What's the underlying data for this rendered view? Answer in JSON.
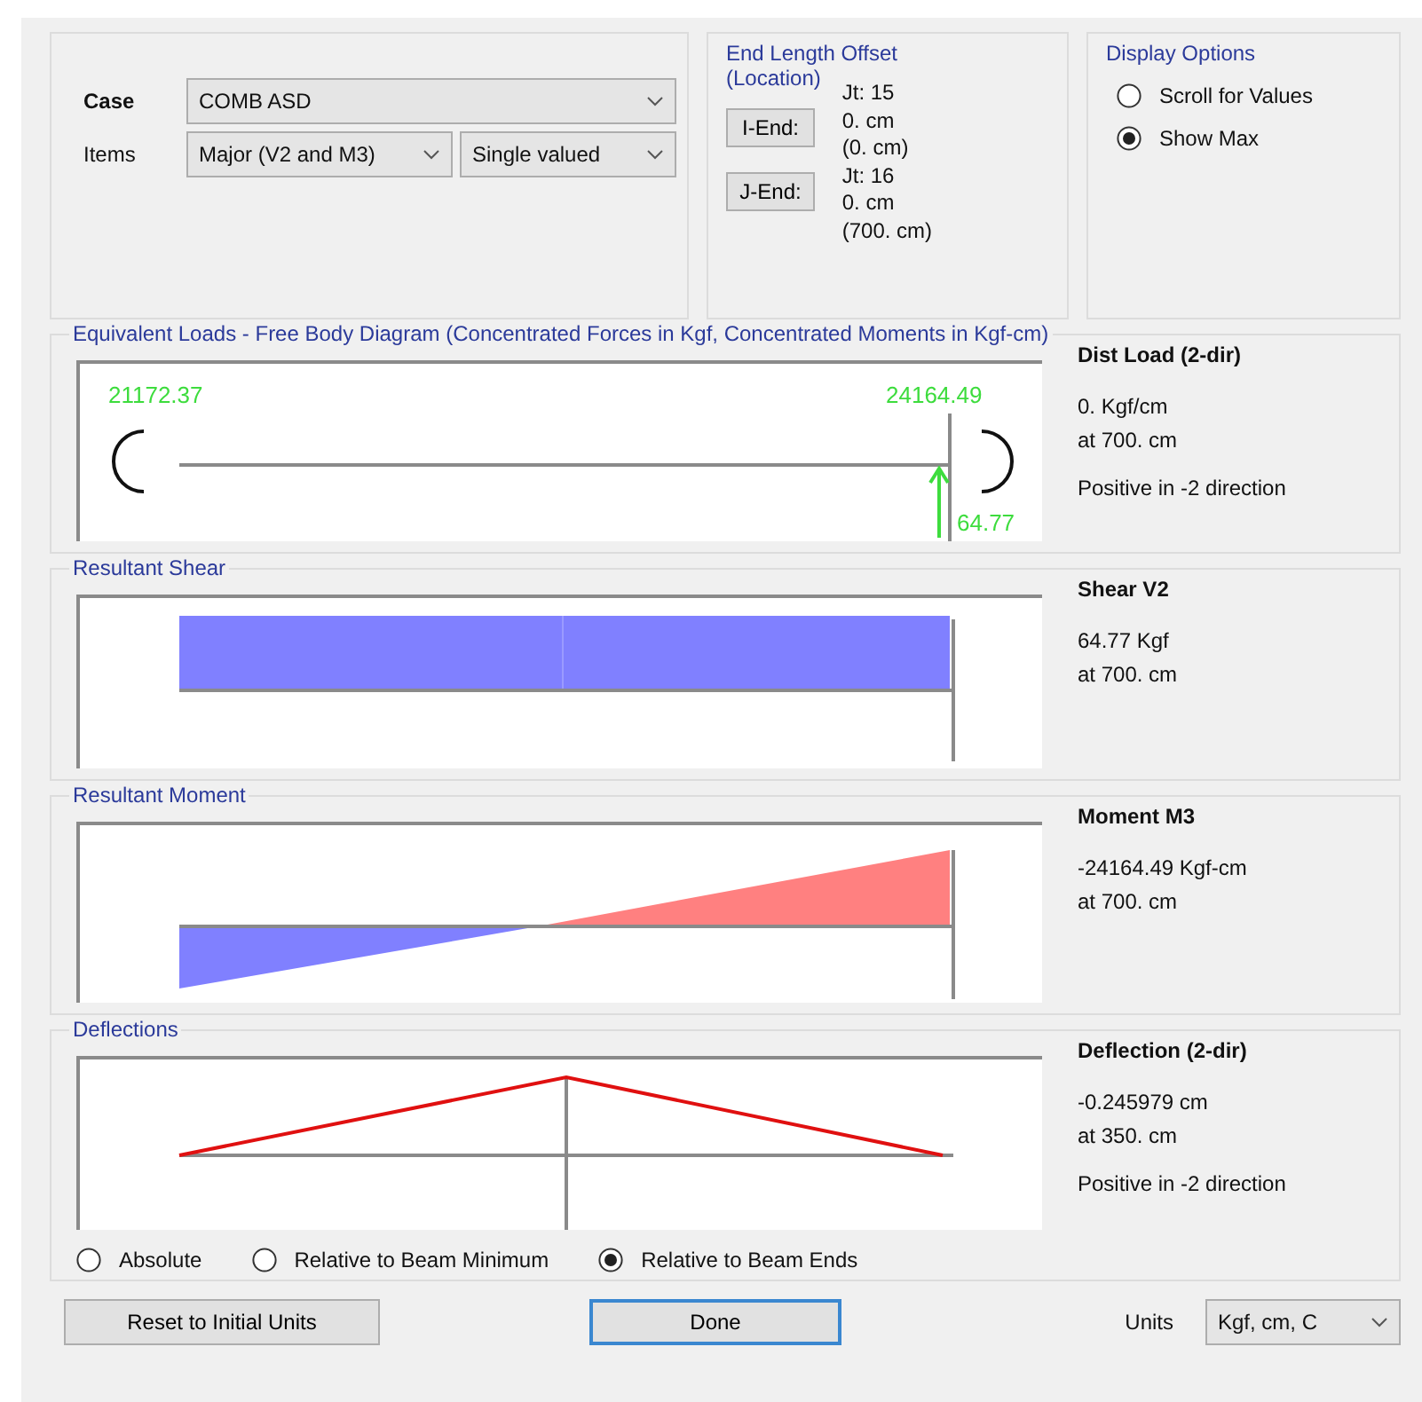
{
  "case_group": {
    "case_label": "Case",
    "case_value": "COMB ASD",
    "items_label": "Items",
    "component": "Major (V2 and M3)",
    "value_type": "Single valued"
  },
  "end_offset": {
    "title": "End Length Offset",
    "subtitle": "(Location)",
    "ends": [
      {
        "joint": "Jt:  15",
        "button": "I-End:",
        "offset": "0. cm",
        "location": "(0. cm)"
      },
      {
        "joint": "Jt:  16",
        "button": "J-End:",
        "offset": "0. cm",
        "location": "(700. cm)"
      }
    ]
  },
  "display_options": {
    "title": "Display Options",
    "options": [
      {
        "label": "Scroll for Values",
        "selected": false
      },
      {
        "label": "Show Max",
        "selected": true
      }
    ]
  },
  "panels": [
    {
      "kind": "loads",
      "title": "Equivalent Loads - Free Body Diagram  (Concentrated Forces in Kgf, Concentrated Moments in Kgf-cm)",
      "left_value": "21172.37",
      "right_value": "24164.49",
      "end_force": "64.77",
      "info_title": "Dist Load (2-dir)",
      "info_lines": [
        "0. Kgf/cm",
        "at 700. cm"
      ],
      "info_note": "Positive in -2 direction"
    },
    {
      "kind": "shear",
      "title": "Resultant Shear",
      "info_title": "Shear V2",
      "info_lines": [
        "64.77 Kgf",
        "at 700. cm"
      ]
    },
    {
      "kind": "moment",
      "title": "Resultant Moment",
      "info_title": "Moment M3",
      "info_lines": [
        "-24164.49 Kgf-cm",
        "at 700. cm"
      ]
    },
    {
      "kind": "deflection",
      "title": "Deflections",
      "info_title": "Deflection (2-dir)",
      "info_lines": [
        "-0.245979 cm",
        "at 350. cm"
      ],
      "info_note": "Positive in -2 direction"
    }
  ],
  "deflection_modes": [
    {
      "label": "Absolute",
      "selected": false
    },
    {
      "label": "Relative to Beam Minimum",
      "selected": false
    },
    {
      "label": "Relative to Beam Ends",
      "selected": true
    }
  ],
  "buttons": {
    "reset": "Reset to Initial Units",
    "done": "Done"
  },
  "units": {
    "label": "Units",
    "value": "Kgf, cm, C"
  }
}
